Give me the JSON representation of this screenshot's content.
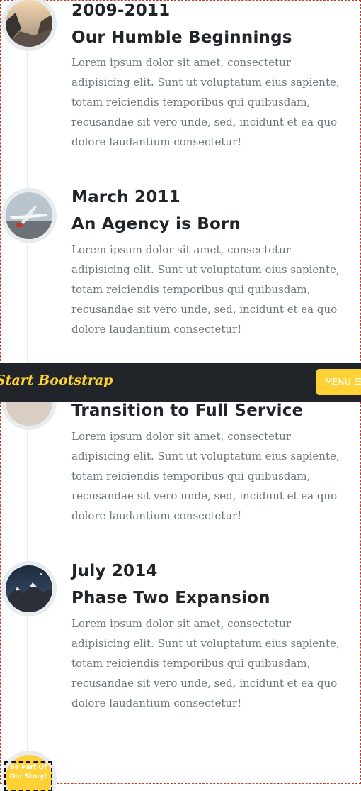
{
  "timeline": [
    {
      "date": "2009-2011",
      "title": "Our Humble Beginnings",
      "body": "Lorem ipsum dolor sit amet, consectetur adipisicing elit. Sunt ut voluptatum eius sapiente, totam reiciendis temporibus qui quibusdam, recusandae sit vero unde, sed, incidunt et ea quo dolore laudantium consectetur!",
      "image": "mountain-valley-photo"
    },
    {
      "date": "March 2011",
      "title": "An Agency is Born",
      "body": "Lorem ipsum dolor sit amet, consectetur adipisicing elit. Sunt ut voluptatum eius sapiente, totam reiciendis temporibus qui quibusdam, recusandae sit vero unde, sed, incidunt et ea quo dolore laudantium consectetur!",
      "image": "airplane-photo"
    },
    {
      "title": "Transition to Full Service",
      "body": "Lorem ipsum dolor sit amet, consectetur adipisicing elit. Sunt ut voluptatum eius sapiente, totam reiciendis temporibus qui quibusdam, recusandae sit vero unde, sed, incidunt et ea quo dolore laudantium consectetur!",
      "image": "desk-photo"
    },
    {
      "date": "July 2014",
      "title": "Phase Two Expansion",
      "body": "Lorem ipsum dolor sit amet, consectetur adipisicing elit. Sunt ut voluptatum eius sapiente, totam reiciendis temporibus qui quibusdam, recusandae sit vero unde, sed, incidunt et ea quo dolore laudantium consectetur!",
      "image": "night-mountain-photo"
    }
  ],
  "navbar": {
    "brand": "Start Bootstrap",
    "menu_label": "MENU",
    "menu_icon": "hamburger-icon"
  },
  "final_step": {
    "text": "Be Part Of Our Story!"
  },
  "colors": {
    "accent": "#fed136",
    "navbar_bg": "#212529",
    "text_muted": "#6c757d",
    "heading": "#212529",
    "timeline_line": "#e9ecef"
  }
}
